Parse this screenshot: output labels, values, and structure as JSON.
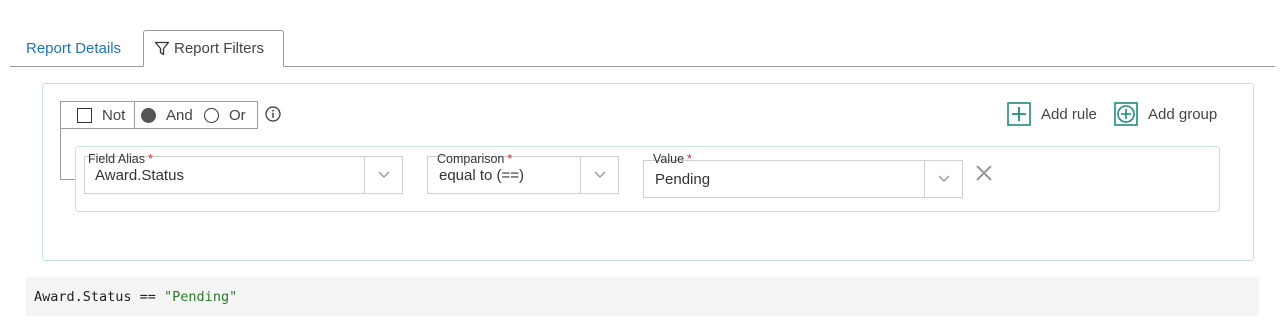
{
  "tabs": {
    "details_label": "Report Details",
    "filters_label": "Report Filters"
  },
  "logic": {
    "not_label": "Not",
    "and_label": "And",
    "or_label": "Or",
    "selected": "And"
  },
  "actions": {
    "add_rule_label": "Add rule",
    "add_group_label": "Add group"
  },
  "rule": {
    "field_alias": {
      "label": "Field Alias",
      "required_mark": "*",
      "value": "Award.Status"
    },
    "comparison": {
      "label": "Comparison",
      "required_mark": "*",
      "value": "equal to (==)"
    },
    "value": {
      "label": "Value",
      "required_mark": "*",
      "value": "Pending"
    }
  },
  "expression": {
    "lhs": "Award.Status == ",
    "rhs": "\"Pending\""
  },
  "colors": {
    "accent_teal": "#1f8a7a",
    "link_blue": "#1e73be",
    "required_red": "#d03030",
    "string_green": "#2a7a2a"
  }
}
